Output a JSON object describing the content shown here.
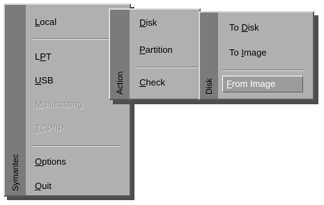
{
  "menus": {
    "main": {
      "strip_label": "Symantec",
      "items": [
        {
          "label": "Local",
          "accel": "L",
          "rest": "ocal",
          "enabled": true
        },
        {
          "label": "LPT",
          "accel": "P",
          "pre": "L",
          "rest": "T",
          "enabled": true
        },
        {
          "label": "USB",
          "accel": "U",
          "rest": "SB",
          "enabled": true
        },
        {
          "label": "Multicasting",
          "accel": "M",
          "rest": "ulticasting",
          "enabled": false
        },
        {
          "label": "TCP/IP",
          "accel": "T",
          "rest": "CP/IP",
          "enabled": false
        },
        {
          "label": "Options",
          "accel": "O",
          "rest": "ptions",
          "enabled": true
        },
        {
          "label": "Quit",
          "accel": "Q",
          "rest": "uit",
          "enabled": true
        }
      ]
    },
    "action": {
      "strip_label": "Action",
      "items": [
        {
          "label": "Disk",
          "accel": "D",
          "rest": "isk"
        },
        {
          "label": "Partition",
          "accel": "P",
          "rest": "artition"
        },
        {
          "label": "Check",
          "accel": "C",
          "rest": "heck"
        }
      ]
    },
    "disk": {
      "strip_label": "Disk",
      "items": [
        {
          "label": "To Disk",
          "pre": "To ",
          "accel": "D",
          "rest": "isk"
        },
        {
          "label": "To Image",
          "pre": "To ",
          "accel": "I",
          "rest": "mage"
        },
        {
          "label": "From Image",
          "accel": "F",
          "rest": "rom Image",
          "selected": true
        }
      ]
    }
  }
}
